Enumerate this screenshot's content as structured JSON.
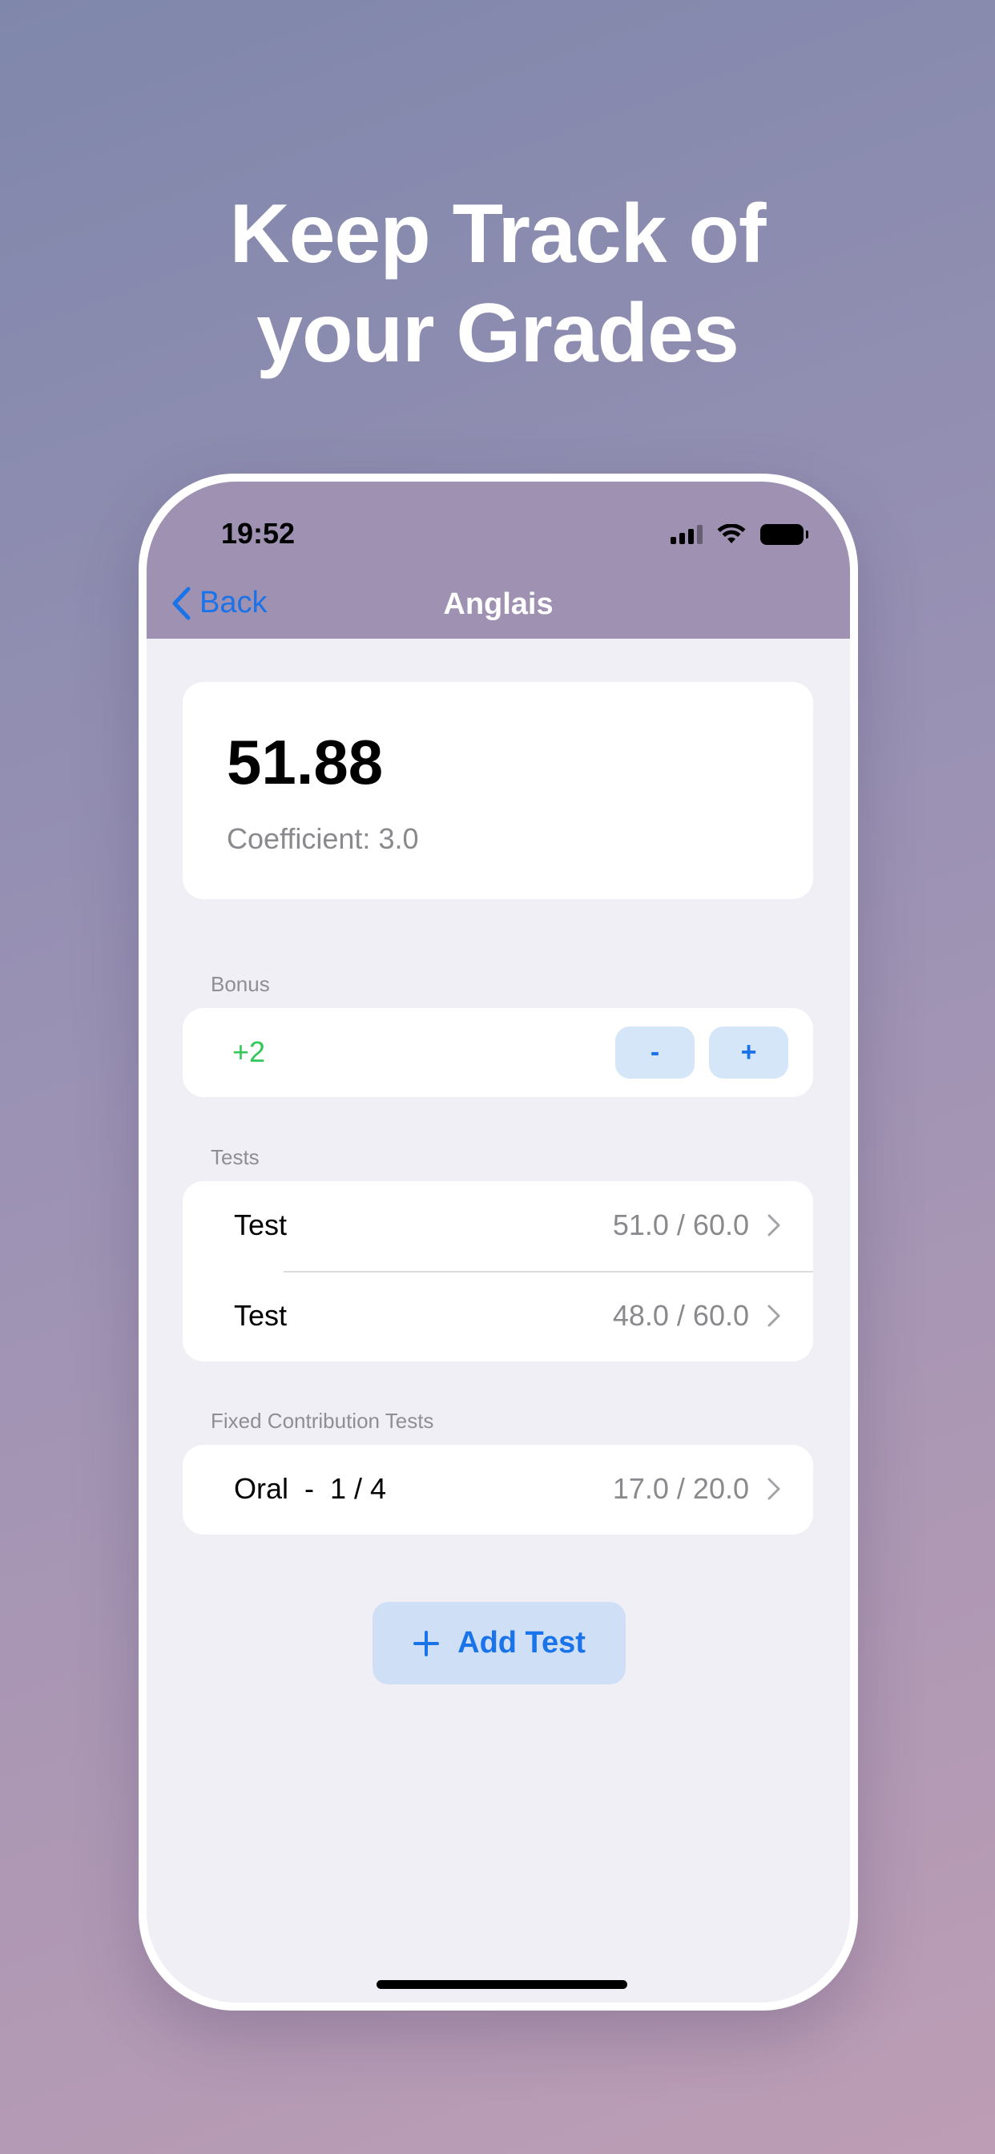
{
  "headline": {
    "line1": "Keep Track of",
    "line2": "your Grades"
  },
  "status_bar": {
    "time": "19:52",
    "icons": [
      "cellular-signal-icon",
      "wifi-icon",
      "battery-icon"
    ]
  },
  "nav": {
    "back_label": "Back",
    "title": "Anglais"
  },
  "summary": {
    "average": "51.88",
    "coefficient": "Coefficient: 3.0"
  },
  "bonus": {
    "section_label": "Bonus",
    "value": "+2",
    "decrement_label": "-",
    "increment_label": "+"
  },
  "tests": {
    "section_label": "Tests",
    "items": [
      {
        "name": "Test",
        "score": "51.0 / 60.0"
      },
      {
        "name": "Test",
        "score": "48.0 / 60.0"
      }
    ]
  },
  "fixed_contribution": {
    "section_label": "Fixed Contribution Tests",
    "items": [
      {
        "name": "Oral  -  1 / 4",
        "score": "17.0 / 20.0"
      }
    ]
  },
  "add_test": {
    "label": "Add Test"
  },
  "colors": {
    "accent": "#1a73e8",
    "bonus_positive": "#34c759",
    "nav_bar": "#9f91b1",
    "screen_background": "#f1eff6"
  }
}
